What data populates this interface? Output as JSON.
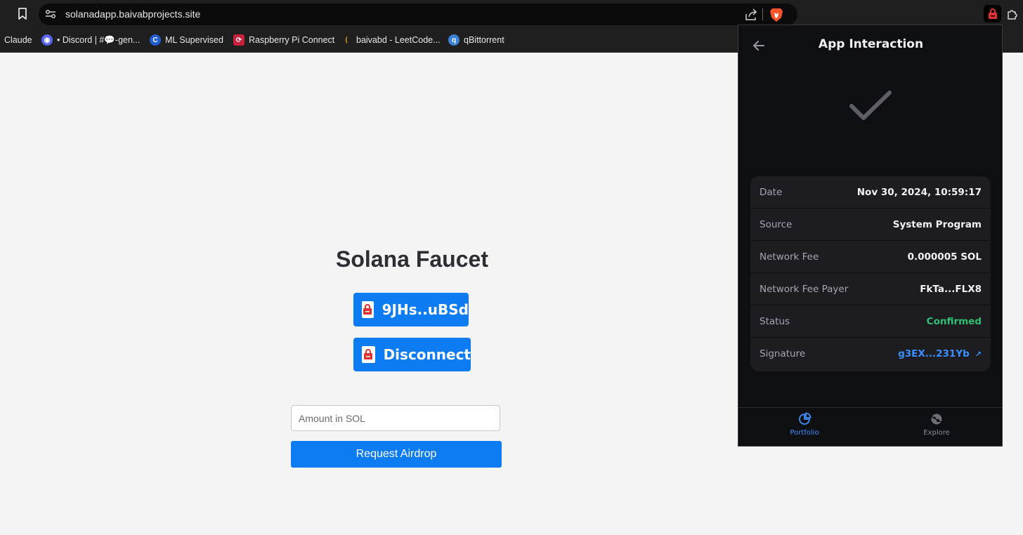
{
  "browser": {
    "url": "solanadapp.baivabprojects.site",
    "bookmarks": [
      {
        "label": "Claude",
        "icon": "none",
        "color": ""
      },
      {
        "label": "• Discord | #💬-gen...",
        "icon": "discord-icon",
        "color": "#5865f2"
      },
      {
        "label": "ML Supervised",
        "icon": "coursera-icon",
        "color": "#1f5fd1"
      },
      {
        "label": "Raspberry Pi Connect",
        "icon": "raspberry-pi-icon",
        "color": "#c8213c"
      },
      {
        "label": "baivabd - LeetCode...",
        "icon": "leetcode-icon",
        "color": "#f0a020"
      },
      {
        "label": "qBittorrent",
        "icon": "qbittorrent-icon",
        "color": "#3b82d6"
      }
    ]
  },
  "page": {
    "title": "Solana Faucet",
    "wallet_button_label": "9JHs..uBSd",
    "disconnect_label": "Disconnect",
    "amount_placeholder": "Amount in SOL",
    "airdrop_label": "Request Airdrop",
    "accent_color": "#0d7cf2"
  },
  "popup": {
    "title": "App Interaction",
    "details": [
      {
        "label": "Date",
        "value": "Nov 30, 2024, 10:59:17"
      },
      {
        "label": "Source",
        "value": "System Program"
      },
      {
        "label": "Network Fee",
        "value": "0.000005 SOL"
      },
      {
        "label": "Network Fee Payer",
        "value": "FkTa...FLX8"
      },
      {
        "label": "Status",
        "value": "Confirmed"
      },
      {
        "label": "Signature",
        "value": "g3EX...231Yb"
      }
    ],
    "tabs": {
      "portfolio": "Portfolio",
      "explore": "Explore"
    },
    "status_color": "#2ec173",
    "link_color": "#3a8fff"
  }
}
